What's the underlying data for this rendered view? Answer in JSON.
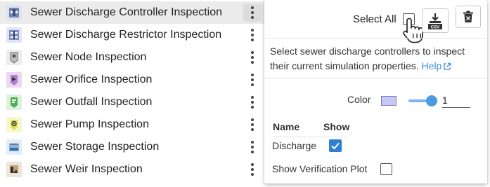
{
  "list": {
    "items": [
      {
        "label": "Sewer Discharge Controller Inspection",
        "icon": "discharge-controller-icon",
        "color": "#6f87b8"
      },
      {
        "label": "Sewer Discharge Restrictor Inspection",
        "icon": "discharge-restrictor-icon",
        "color": "#7f8fc8"
      },
      {
        "label": "Sewer Node Inspection",
        "icon": "node-icon",
        "color": "#c9c9c9"
      },
      {
        "label": "Sewer Orifice Inspection",
        "icon": "orifice-icon",
        "color": "#b07ed0"
      },
      {
        "label": "Sewer Outfall Inspection",
        "icon": "outfall-icon",
        "color": "#4caf50"
      },
      {
        "label": "Sewer Pump Inspection",
        "icon": "pump-icon",
        "color": "#e0e05a"
      },
      {
        "label": "Sewer Storage Inspection",
        "icon": "storage-icon",
        "color": "#8fb3dc"
      },
      {
        "label": "Sewer Weir Inspection",
        "icon": "weir-icon",
        "color": "#bfa27a"
      }
    ]
  },
  "panel": {
    "select_all_label": "Select All",
    "csv_label": "CSV",
    "description": "Select sewer discharge controllers to inspect their current simulation properties.",
    "help_label": "Help",
    "color_label": "Color",
    "color_value": "#c7c8f5",
    "slider_value": "1",
    "table": {
      "headers": [
        "Name",
        "Show"
      ],
      "rows": [
        {
          "name": "Discharge",
          "show": true
        }
      ]
    },
    "verification_label": "Show Verification Plot",
    "accent": "#2f80d0"
  }
}
